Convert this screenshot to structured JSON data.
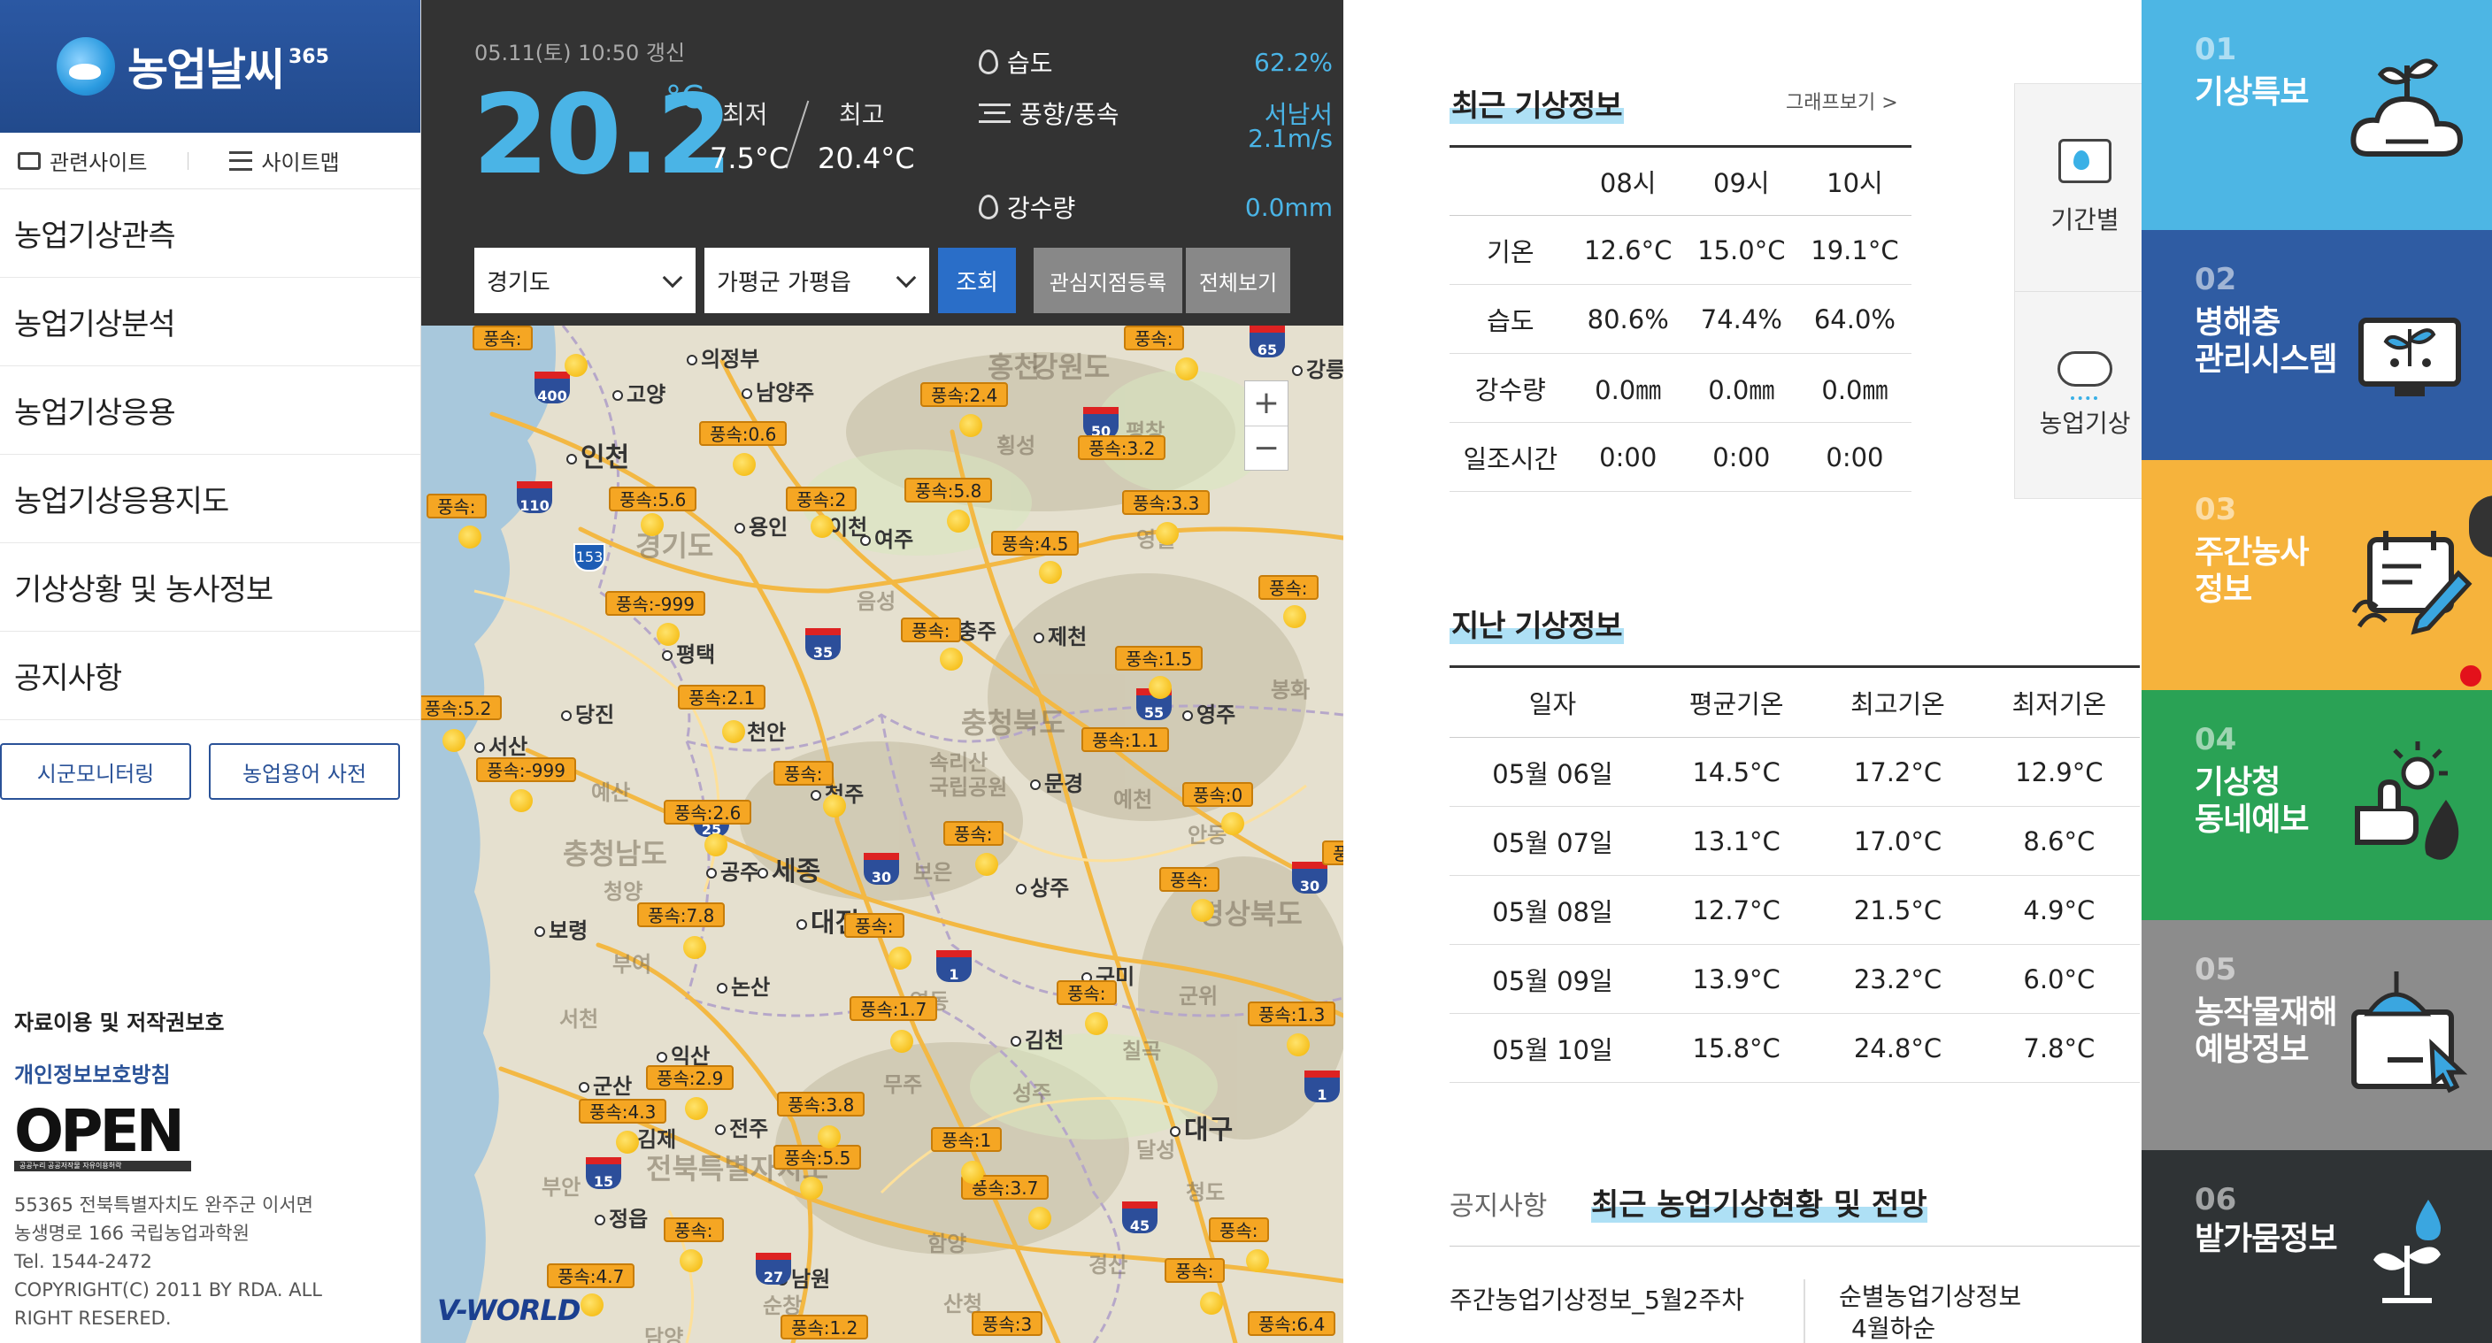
{
  "sidebar": {
    "logo_text": "농업날씨",
    "logo_sup": "365",
    "util": {
      "related_sites": "관련사이트",
      "sitemap": "사이트맵"
    },
    "nav": [
      "농업기상관측",
      "농업기상분석",
      "농업기상응용",
      "농업기상응용지도",
      "기상상황 및 농사정보",
      "공지사항"
    ],
    "buttons": {
      "monitoring": "시군모니터링",
      "dictionary": "농업용어 사전"
    },
    "copyright_title": "자료이용 및 저작권보호",
    "privacy": "개인정보보호방침",
    "open_logo": "OPEN",
    "open_sub": "공공누리   공공저작물 자유이용허락",
    "address_lines": [
      "55365 전북특별자치도 완주군 이서면",
      "농생명로 166 국립농업과학원",
      "Tel. 1544-2472",
      "COPYRIGHT(C) 2011 BY RDA. ALL",
      "RIGHT RESERED."
    ]
  },
  "weather": {
    "updated": "05.11(토) 10:50 갱신",
    "temp_now": "20.2",
    "temp_unit": "°C",
    "min_label": "최저",
    "max_label": "최고",
    "min_val": "7.5°C",
    "max_val": "20.4°C",
    "humidity_label": "습도",
    "humidity_val": "62.2%",
    "wind_label": "풍향/풍속",
    "wind_dir": "서남서",
    "wind_speed": "2.1m/s",
    "rain_label": "강수량",
    "rain_val": "0.0mm"
  },
  "filter": {
    "province": "경기도",
    "station": "가평군 가평읍",
    "search": "조회",
    "register": "관심지점등록",
    "view_all": "전체보기"
  },
  "map": {
    "zoom_in": "+",
    "zoom_out": "−",
    "brand": "V-WORLD",
    "wind_tags": [
      "풍속:",
      "풍속:",
      "풍속:2.4",
      "풍속:0.6",
      "풍속:3.2",
      "풍속:",
      "풍속:5.6",
      "풍속:2",
      "풍속:5.8",
      "풍속:3.3",
      "풍속:4.5",
      "풍속:-999",
      "풍속:",
      "풍속:",
      "풍속:1.5",
      "풍속:5.2",
      "풍속:2.1",
      "풍속:1.1",
      "풍속:-999",
      "풍속:",
      "풍속:0",
      "풍속:2.6",
      "풍속:",
      "풍속:",
      "풍속:",
      "풍속:7.8",
      "풍속:",
      "풍속:",
      "풍속:1.7",
      "풍속:1.3",
      "풍속:2.9",
      "풍속:4.3",
      "풍속:3.8",
      "풍속:1",
      "풍속:5.5",
      "풍속:3.7",
      "풍속:",
      "풍속:",
      "풍속:4.7",
      "풍속:",
      "풍속:1.2",
      "풍속:3",
      "풍속:6.4"
    ],
    "cities": [
      "의정부",
      "고양",
      "남양주",
      "인천",
      "용인",
      "이천",
      "여주",
      "평택",
      "충주",
      "제천",
      "당진",
      "서산",
      "천안",
      "영주",
      "청주",
      "문경",
      "세종",
      "공주",
      "보령",
      "대전",
      "상주",
      "논산",
      "구미",
      "김천",
      "익산",
      "군산",
      "전주",
      "김제",
      "대구",
      "정읍",
      "남원",
      "강릉"
    ],
    "regions": [
      "강원도",
      "경기도",
      "충청북도",
      "충청남도",
      "경상북도",
      "전북특별자치도",
      "속리산\n국립공원",
      "홍천",
      "횡성",
      "평창",
      "영월",
      "음성",
      "봉화",
      "예천",
      "청양",
      "부여",
      "서천",
      "보은",
      "영동",
      "무주",
      "성주",
      "칠곡",
      "달성",
      "함양",
      "담양",
      "청도",
      "경산",
      "횡성",
      "예산",
      "부안",
      "산청",
      "순창",
      "안동",
      "군위"
    ],
    "highways": [
      "400",
      "65",
      "110",
      "50",
      "153",
      "35",
      "55",
      "25",
      "30",
      "1",
      "30",
      "15",
      "1",
      "27",
      "45"
    ]
  },
  "recent": {
    "title": "최근 기상정보",
    "graph_link": "그래프보기 >",
    "headers": [
      "",
      "08시",
      "09시",
      "10시"
    ],
    "rows": [
      [
        "기온",
        "12.6°C",
        "15.0°C",
        "19.1°C"
      ],
      [
        "습도",
        "80.6%",
        "74.4%",
        "64.0%"
      ],
      [
        "강수량",
        "0.0㎜",
        "0.0㎜",
        "0.0㎜"
      ],
      [
        "일조시간",
        "0:00",
        "0:00",
        "0:00"
      ]
    ]
  },
  "side_card": {
    "item1": "기간별",
    "item2": "농업기상"
  },
  "past": {
    "title": "지난 기상정보",
    "headers": [
      "일자",
      "평균기온",
      "최고기온",
      "최저기온"
    ],
    "rows": [
      [
        "05월 06일",
        "14.5°C",
        "17.2°C",
        "12.9°C"
      ],
      [
        "05월 07일",
        "13.1°C",
        "17.0°C",
        "8.6°C"
      ],
      [
        "05월 08일",
        "12.7°C",
        "21.5°C",
        "4.9°C"
      ],
      [
        "05월 09일",
        "13.9°C",
        "23.2°C",
        "6.0°C"
      ],
      [
        "05월 10일",
        "15.8°C",
        "24.8°C",
        "7.8°C"
      ]
    ]
  },
  "notice": {
    "tab": "공지사항",
    "active_tab": "최근 농업기상현황 및 전망",
    "item1": "주간농업기상정보_5월2주차",
    "item2_line1": "순별농업기상정보",
    "item2_line2": "4월하순"
  },
  "menu": [
    {
      "num": "01",
      "label": "기상특보",
      "color": "#4db6e4",
      "icon": "cloud-sprout-icon"
    },
    {
      "num": "02",
      "label": "병해충\n관리시스템",
      "color": "#2f5ca3",
      "icon": "monitor-plant-icon"
    },
    {
      "num": "03",
      "label": "주간농사\n정보",
      "color": "#f6b33c",
      "icon": "calendar-pencil-icon"
    },
    {
      "num": "04",
      "label": "기상청\n동네예보",
      "color": "#2aa255",
      "icon": "hand-weather-icon"
    },
    {
      "num": "05",
      "label": "농작물재해\n예방정보",
      "color": "#8c8c8c",
      "icon": "umbrella-pointer-icon"
    },
    {
      "num": "06",
      "label": "밭가뭄정보",
      "color": "#2f3335",
      "icon": "drought-sprout-icon"
    }
  ]
}
